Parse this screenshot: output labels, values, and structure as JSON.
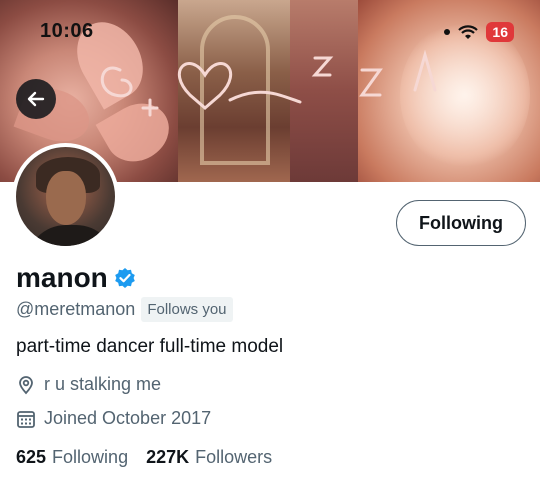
{
  "status_bar": {
    "time": "10:06",
    "battery": "16"
  },
  "profile": {
    "display_name": "manon",
    "handle": "@meretmanon",
    "follows_you": "Follows you",
    "bio": "part-time dancer full-time model",
    "location": "r u stalking me",
    "joined": "Joined October 2017",
    "following_button": "Following",
    "stats": {
      "following_count": "625",
      "following_label": "Following",
      "followers_count": "227K",
      "followers_label": "Followers"
    }
  },
  "colors": {
    "verified": "#1d9bf0",
    "muted_text": "#536471",
    "battery": "#e0383a"
  },
  "icons": [
    "back-arrow-icon",
    "verified-badge-icon",
    "location-pin-icon",
    "calendar-icon",
    "wifi-icon"
  ]
}
